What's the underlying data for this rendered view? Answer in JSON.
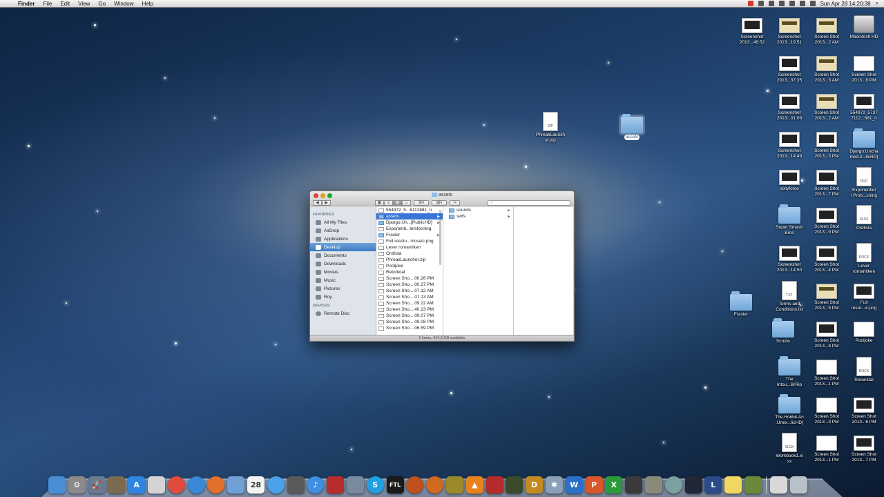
{
  "menubar": {
    "apple": "",
    "items": [
      "Finder",
      "File",
      "Edit",
      "View",
      "Go",
      "Window",
      "Help"
    ],
    "clock": "Sun Apr 28  14:20:38"
  },
  "desktop_icons": [
    {
      "label": "Screenshot\n2013...46.52",
      "kind": "thumb-dark"
    },
    {
      "label": "Screenshot\n2013...19.51",
      "kind": "thumb-tan"
    },
    {
      "label": "Screen Shot\n2013...2 AM",
      "kind": "thumb-tan"
    },
    {
      "label": "Macintosh HD",
      "kind": "disk"
    },
    {
      "label": "Screenshot\n2013...37.35",
      "kind": "thumb-dark"
    },
    {
      "label": "Screen Shot\n2013...3 AM",
      "kind": "thumb-tan"
    },
    {
      "label": "Screen Shot\n2013...8 PM",
      "kind": "thumb"
    },
    {
      "label": "Screenshot\n2013...01.09",
      "kind": "thumb-dark"
    },
    {
      "label": "Screen Shot\n2013...2 AM",
      "kind": "thumb-tan"
    },
    {
      "label": "554972_5737\n7112...681_n",
      "kind": "thumb-dark"
    },
    {
      "label": "Screenshot\n2013...14.49",
      "kind": "thumb-dark"
    },
    {
      "label": "Screen Shot\n2013...3 PM",
      "kind": "thumb-dark"
    },
    {
      "label": "Django.Uncha\nined.2...licHD]",
      "kind": "folder"
    },
    {
      "label": "sixtyforce",
      "kind": "thumb-dark"
    },
    {
      "label": "Screen Shot\n2013...7 PM",
      "kind": "thumb-dark"
    },
    {
      "label": "Exponentiel\nl Prob...sning",
      "kind": "doc",
      "tag": "DOC"
    },
    {
      "label": "Super Smash\nBros",
      "kind": "folder"
    },
    {
      "label": "Screen Shot\n2013...9 PM",
      "kind": "thumb-dark"
    },
    {
      "label": "Ordlista",
      "kind": "doc",
      "tag": "SLSX"
    },
    {
      "label": "Screenshot\n2013...14.50",
      "kind": "thumb-dark"
    },
    {
      "label": "Screen Shot\n2013...4 PM",
      "kind": "thumb-dark"
    },
    {
      "label": "Lever\nromantiken",
      "kind": "doc",
      "tag": "DOCX"
    },
    {
      "label": "Terms and\nConditions.txt",
      "kind": "doc",
      "tag": "TXT"
    },
    {
      "label": "Screen Shot\n2013...5 PM",
      "kind": "thumb-tan"
    },
    {
      "label": "Full\nresol...ic.png",
      "kind": "thumb-dark"
    },
    {
      "label": "Frasier",
      "kind": "folder"
    },
    {
      "label": "Scrubs",
      "kind": "folder"
    },
    {
      "label": "Screen Shot\n2013...8 PM",
      "kind": "thumb-dark"
    },
    {
      "label": "Pooljoke",
      "kind": "thumb"
    },
    {
      "label": "The\nIntou...BrRip",
      "kind": "folder"
    },
    {
      "label": "Screen Shot\n2013...1 PM",
      "kind": "thumb"
    },
    {
      "label": "Retoriktal",
      "kind": "doc",
      "tag": "DOCX"
    },
    {
      "label": "The.Hobbit.An\n.Unex...licHD]",
      "kind": "folder"
    },
    {
      "label": "Screen Shot\n2013...3 PM",
      "kind": "thumb"
    },
    {
      "label": "Screen Shot\n2013...6 PM",
      "kind": "thumb-dark"
    },
    {
      "label": "Workbook1.xl\nsx",
      "kind": "doc",
      "tag": "XLSX"
    },
    {
      "label": "Screen Shot\n2013...1 PM",
      "kind": "thumb"
    },
    {
      "label": "Screen Shot\n2013...7 PM",
      "kind": "thumb-dark"
    },
    {
      "label": "PhreakLaunch\ner.zip",
      "kind": "doc",
      "tag": "ZIP"
    },
    {
      "label": "assets",
      "kind": "folder",
      "selected": true
    }
  ],
  "finder": {
    "title": "assets",
    "search_placeholder": "",
    "sidebar": {
      "favorites_header": "FAVORITES",
      "favorites": [
        "All My Files",
        "AirDrop",
        "Applications",
        "Desktop",
        "Documents",
        "Downloads",
        "Movies",
        "Music",
        "Pictures",
        "Roy"
      ],
      "selected": "Desktop",
      "devices_header": "DEVICES",
      "devices": [
        "Remote Disc"
      ]
    },
    "column1": [
      {
        "name": "554972_5...6112681_n",
        "folder": false
      },
      {
        "name": "assets",
        "folder": true,
        "selected": true,
        "arrow": true
      },
      {
        "name": "Django.Un...[PublicHD]",
        "folder": true,
        "arrow": true
      },
      {
        "name": "Exponenti...lemlösning",
        "folder": false
      },
      {
        "name": "Frasier",
        "folder": true,
        "arrow": true
      },
      {
        "name": "Full resolu...mosaic.png",
        "folder": false
      },
      {
        "name": "Lever romantiken",
        "folder": false
      },
      {
        "name": "Ordlista",
        "folder": false
      },
      {
        "name": "PhreakLauncher.zip",
        "folder": false
      },
      {
        "name": "Pooljoke",
        "folder": false
      },
      {
        "name": "Retoriktal",
        "folder": false
      },
      {
        "name": "Screen Sho....00.26 PM",
        "folder": false
      },
      {
        "name": "Screen Sho....00.27 PM",
        "folder": false
      },
      {
        "name": "Screen Sho....07.12 AM",
        "folder": false
      },
      {
        "name": "Screen Sho....07.13 AM",
        "folder": false
      },
      {
        "name": "Screen Sho....09.22 AM",
        "folder": false
      },
      {
        "name": "Screen Sho....40.23 PM",
        "folder": false
      },
      {
        "name": "Screen Sho....09.07 PM",
        "folder": false
      },
      {
        "name": "Screen Sho....09.08 PM",
        "folder": false
      },
      {
        "name": "Screen Sho....06.59 PM",
        "folder": false
      }
    ],
    "column2": [
      {
        "name": "sounds",
        "folder": true,
        "arrow": true
      },
      {
        "name": "swfs",
        "folder": true,
        "arrow": true
      }
    ],
    "status": "2 items, 414,3 GB available"
  },
  "dock": [
    {
      "name": "finder-icon",
      "color": "#4a8fd6",
      "glyph": ""
    },
    {
      "name": "system-preferences-icon",
      "color": "#8a8a8a",
      "glyph": "⚙"
    },
    {
      "name": "launchpad-icon",
      "color": "#6c7a90",
      "glyph": "🚀"
    },
    {
      "name": "preview-icon",
      "color": "#7a6a50",
      "glyph": ""
    },
    {
      "name": "app-store-icon",
      "color": "#2f86e0",
      "glyph": "A"
    },
    {
      "name": "textedit-icon",
      "color": "#d4d4d4",
      "glyph": ""
    },
    {
      "name": "chrome-icon",
      "color": "#e04b3b",
      "glyph": "",
      "round": true
    },
    {
      "name": "safari-icon",
      "color": "#3a88d8",
      "glyph": "",
      "round": true
    },
    {
      "name": "firefox-icon",
      "color": "#e0702b",
      "glyph": "",
      "round": true
    },
    {
      "name": "pages-icon",
      "color": "#6fa0d8",
      "glyph": ""
    },
    {
      "name": "calendar-icon",
      "color": "#f4f4f4",
      "glyph": "28"
    },
    {
      "name": "messages-icon",
      "color": "#4aa3e8",
      "glyph": "",
      "round": true
    },
    {
      "name": "facetime-icon",
      "color": "#5a5a5a",
      "glyph": ""
    },
    {
      "name": "itunes-icon",
      "color": "#3f8ee0",
      "glyph": "♪",
      "round": true
    },
    {
      "name": "photo-booth-icon",
      "color": "#b82c2c",
      "glyph": ""
    },
    {
      "name": "iphoto-icon",
      "color": "#7a8a9e",
      "glyph": ""
    },
    {
      "name": "skype-icon",
      "color": "#20a0e0",
      "glyph": "S",
      "round": true
    },
    {
      "name": "ftl-icon",
      "color": "#1a1a1a",
      "glyph": "FTL"
    },
    {
      "name": "game-icon-1",
      "color": "#c0501f",
      "glyph": "",
      "round": true
    },
    {
      "name": "game-icon-2",
      "color": "#d06a20",
      "glyph": "",
      "round": true
    },
    {
      "name": "game-icon-3",
      "color": "#9a8a2a",
      "glyph": ""
    },
    {
      "name": "vlc-icon",
      "color": "#e8831c",
      "glyph": "▲"
    },
    {
      "name": "app-icon-red",
      "color": "#b52a2a",
      "glyph": ""
    },
    {
      "name": "app-icon-film",
      "color": "#3a4a2a",
      "glyph": ""
    },
    {
      "name": "app-icon-d",
      "color": "#c28a20",
      "glyph": "D"
    },
    {
      "name": "app-icon-star",
      "color": "#8aa0b8",
      "glyph": "✱"
    },
    {
      "name": "word-icon",
      "color": "#2a6fc8",
      "glyph": "W"
    },
    {
      "name": "powerpoint-icon",
      "color": "#d8582a",
      "glyph": "P"
    },
    {
      "name": "excel-icon",
      "color": "#2a9a3a",
      "glyph": "X"
    },
    {
      "name": "steam-icon",
      "color": "#3a3a3a",
      "glyph": ""
    },
    {
      "name": "app-icon-bridge",
      "color": "#8a8a7a",
      "glyph": ""
    },
    {
      "name": "app-icon-disc",
      "color": "#7aa0a0",
      "glyph": "",
      "round": true
    },
    {
      "name": "app-icon-dark",
      "color": "#202838",
      "glyph": ""
    },
    {
      "name": "league-icon",
      "color": "#2a4a8a",
      "glyph": "L"
    },
    {
      "name": "stickies-icon",
      "color": "#f0d860",
      "glyph": ""
    },
    {
      "name": "app-icon-green",
      "color": "#6a8a3a",
      "glyph": ""
    },
    {
      "name": "documents-stack-icon",
      "color": "#d8d8d8",
      "glyph": ""
    },
    {
      "name": "trash-icon",
      "color": "#b8c0c8",
      "glyph": ""
    }
  ]
}
